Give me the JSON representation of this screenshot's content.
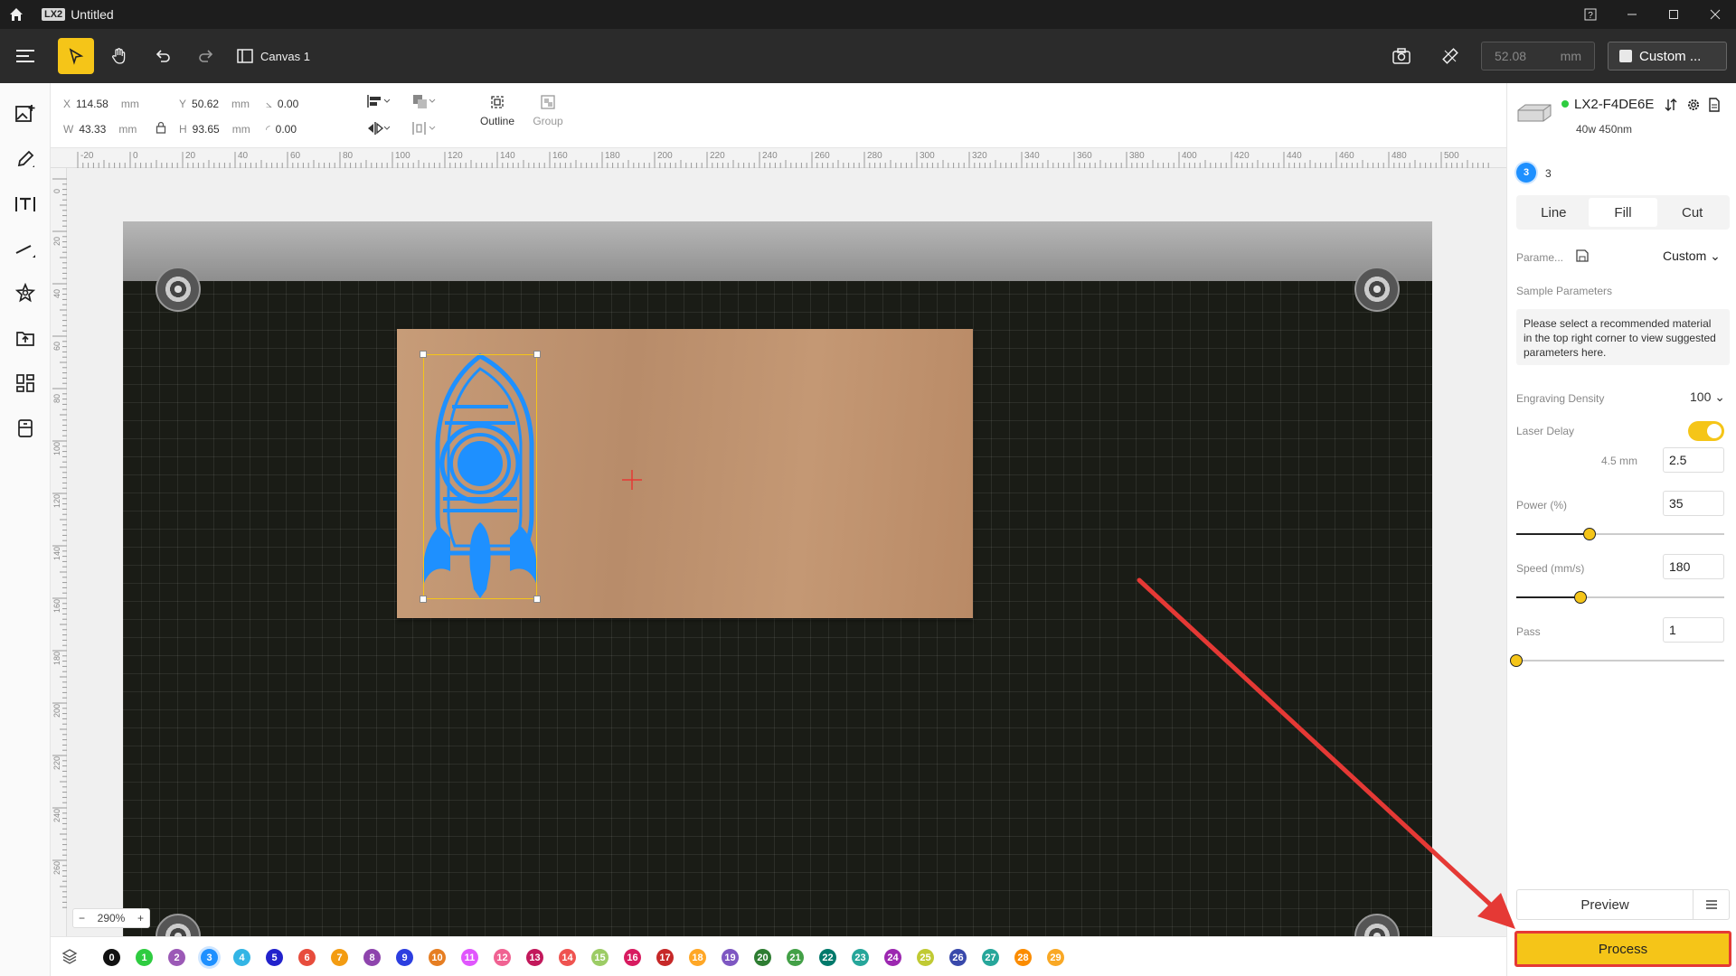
{
  "titlebar": {
    "badge": "LX2",
    "title": "Untitled"
  },
  "toolbar": {
    "canvas_tab": "Canvas 1",
    "zoom_value": "52.08",
    "zoom_unit": "mm",
    "custom_label": "Custom ..."
  },
  "props": {
    "x_key": "X",
    "x_val": "114.58",
    "y_key": "Y",
    "y_val": "50.62",
    "w_key": "W",
    "w_val": "43.33",
    "h_key": "H",
    "h_val": "93.65",
    "unit": "mm",
    "angle": "0.00",
    "radius": "0.00",
    "outline_label": "Outline",
    "group_label": "Group"
  },
  "ruler": {
    "h_ticks": [
      "-20",
      "0",
      "20",
      "40",
      "60",
      "80",
      "100",
      "120",
      "140",
      "160",
      "180",
      "200",
      "220",
      "240",
      "260",
      "280",
      "300",
      "320",
      "340",
      "360",
      "380",
      "400",
      "420",
      "440",
      "460",
      "480",
      "500"
    ],
    "v_ticks": [
      "0",
      "20",
      "40",
      "60",
      "80",
      "100",
      "120",
      "140",
      "160",
      "180",
      "200",
      "220",
      "240",
      "260"
    ]
  },
  "zoom": {
    "label": "290%"
  },
  "layers": [
    {
      "n": "0",
      "c": "#111111"
    },
    {
      "n": "1",
      "c": "#2ecc40"
    },
    {
      "n": "2",
      "c": "#9b59b6"
    },
    {
      "n": "3",
      "c": "#1e90ff"
    },
    {
      "n": "4",
      "c": "#33b5e5"
    },
    {
      "n": "5",
      "c": "#2222cc"
    },
    {
      "n": "6",
      "c": "#e74c3c"
    },
    {
      "n": "7",
      "c": "#f39c12"
    },
    {
      "n": "8",
      "c": "#8e44ad"
    },
    {
      "n": "9",
      "c": "#2c3ee0"
    },
    {
      "n": "10",
      "c": "#e67e22"
    },
    {
      "n": "11",
      "c": "#e056fd"
    },
    {
      "n": "12",
      "c": "#f06292"
    },
    {
      "n": "13",
      "c": "#c2185b"
    },
    {
      "n": "14",
      "c": "#ef5350"
    },
    {
      "n": "15",
      "c": "#9ccc65"
    },
    {
      "n": "16",
      "c": "#d81b60"
    },
    {
      "n": "17",
      "c": "#c62828"
    },
    {
      "n": "18",
      "c": "#ffa726"
    },
    {
      "n": "19",
      "c": "#7e57c2"
    },
    {
      "n": "20",
      "c": "#2e7d32"
    },
    {
      "n": "21",
      "c": "#43a047"
    },
    {
      "n": "22",
      "c": "#00796b"
    },
    {
      "n": "23",
      "c": "#26a69a"
    },
    {
      "n": "24",
      "c": "#9c27b0"
    },
    {
      "n": "25",
      "c": "#c0ca33"
    },
    {
      "n": "26",
      "c": "#3949ab"
    },
    {
      "n": "27",
      "c": "#26a69a"
    },
    {
      "n": "28",
      "c": "#fb8c00"
    },
    {
      "n": "29",
      "c": "#f9a825"
    }
  ],
  "panel": {
    "device_name": "LX2-F4DE6E",
    "device_spec": "40w 450nm",
    "layer_num": "3",
    "layer_label": "3",
    "tabs": [
      "Line",
      "Fill",
      "Cut"
    ],
    "param_label": "Parame...",
    "param_value": "Custom",
    "sample_label": "Sample Parameters",
    "note": "Please select a recommended material in the top right corner to view suggested parameters here.",
    "density_label": "Engraving Density",
    "density_value": "100",
    "laser_delay_label": "Laser Delay",
    "delay_dist": "4.5 mm",
    "delay_value": "2.5",
    "power_label": "Power  (%)",
    "power_value": "35",
    "power_fraction": 0.35,
    "speed_label": "Speed  (mm/s)",
    "speed_value": "180",
    "speed_fraction": 0.31,
    "pass_label": "Pass",
    "pass_value": "1",
    "pass_fraction": 0.0,
    "preview_label": "Preview",
    "process_label": "Process"
  },
  "colors": {
    "accent": "#f5c518",
    "highlight": "#e53935",
    "shape": "#1e90ff"
  }
}
